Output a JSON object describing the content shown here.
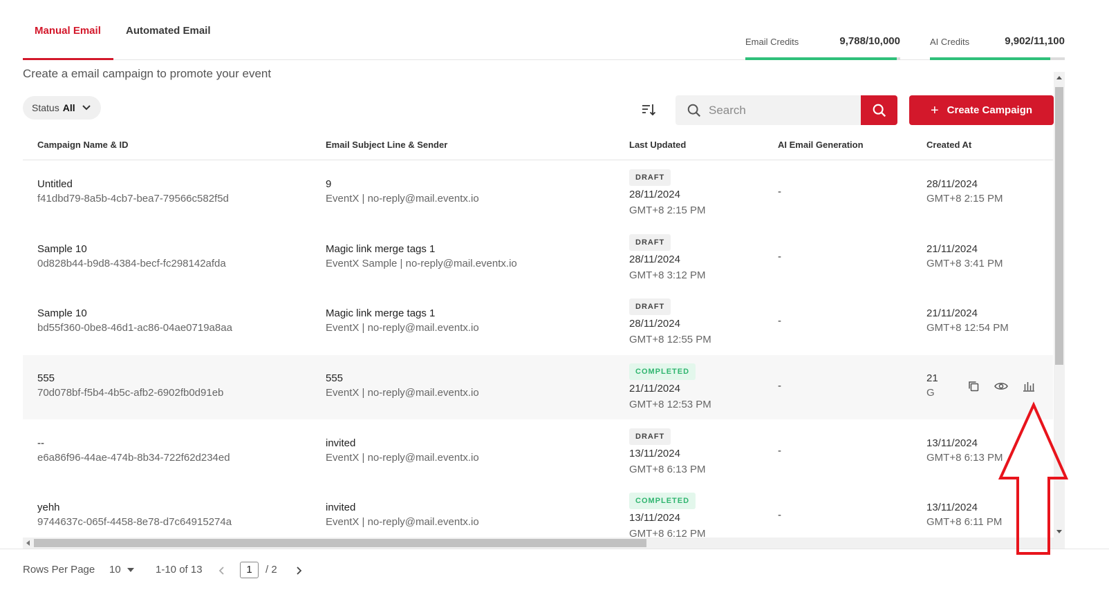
{
  "tabs": [
    {
      "label": "Manual Email",
      "active": true
    },
    {
      "label": "Automated Email",
      "active": false
    }
  ],
  "credits": {
    "email": {
      "label": "Email Credits",
      "value": "9,788/10,000",
      "fraction": 0.9788
    },
    "ai": {
      "label": "AI Credits",
      "value": "9,902/11,100",
      "fraction": 0.892
    }
  },
  "subtitle": "Create a email campaign to promote your event",
  "filter": {
    "label": "Status",
    "value": "All"
  },
  "search": {
    "placeholder": "Search"
  },
  "create_button": {
    "label": "Create Campaign"
  },
  "table": {
    "headers": [
      "Campaign Name & ID",
      "Email Subject Line & Sender",
      "Last Updated",
      "AI Email Generation",
      "Created At"
    ],
    "rows": [
      {
        "name": "Untitled",
        "id": "f41dbd79-8a5b-4cb7-bea7-79566c582f5d",
        "subject": "9",
        "sender": "EventX | no-reply@mail.eventx.io",
        "status": "DRAFT",
        "updated_date": "28/11/2024",
        "updated_time": "GMT+8 2:15 PM",
        "ai": "-",
        "created_date": "28/11/2024",
        "created_time": "GMT+8 2:15 PM"
      },
      {
        "name": "Sample 10",
        "id": "0d828b44-b9d8-4384-becf-fc298142afda",
        "subject": "Magic link merge tags 1",
        "sender": "EventX Sample | no-reply@mail.eventx.io",
        "status": "DRAFT",
        "updated_date": "28/11/2024",
        "updated_time": "GMT+8 3:12 PM",
        "ai": "-",
        "created_date": "21/11/2024",
        "created_time": "GMT+8 3:41 PM"
      },
      {
        "name": "Sample 10",
        "id": "bd55f360-0be8-46d1-ac86-04ae0719a8aa",
        "subject": "Magic link merge tags 1",
        "sender": "EventX | no-reply@mail.eventx.io",
        "status": "DRAFT",
        "updated_date": "28/11/2024",
        "updated_time": "GMT+8 12:55 PM",
        "ai": "-",
        "created_date": "21/11/2024",
        "created_time": "GMT+8 12:54 PM"
      },
      {
        "name": "555",
        "id": "70d078bf-f5b4-4b5c-afb2-6902fb0d91eb",
        "subject": "555",
        "sender": "EventX | no-reply@mail.eventx.io",
        "status": "COMPLETED",
        "updated_date": "21/11/2024",
        "updated_time": "GMT+8 12:53 PM",
        "ai": "-",
        "created_date": "21",
        "created_time": "G"
      },
      {
        "name": "--",
        "id": "e6a86f96-44ae-474b-8b34-722f62d234ed",
        "subject": "invited",
        "sender": "EventX | no-reply@mail.eventx.io",
        "status": "DRAFT",
        "updated_date": "13/11/2024",
        "updated_time": "GMT+8 6:13 PM",
        "ai": "-",
        "created_date": "13/11/2024",
        "created_time": "GMT+8 6:13 PM"
      },
      {
        "name": "yehh",
        "id": "9744637c-065f-4458-8e78-d7c64915274a",
        "subject": "invited",
        "sender": "EventX | no-reply@mail.eventx.io",
        "status": "COMPLETED",
        "updated_date": "13/11/2024",
        "updated_time": "GMT+8 6:12 PM",
        "ai": "-",
        "created_date": "13/11/2024",
        "created_time": "GMT+8 6:11 PM"
      }
    ]
  },
  "row_action_icons": [
    "copy-icon",
    "eye-icon",
    "bar-chart-icon"
  ],
  "pagination": {
    "rows_label": "Rows Per Page",
    "rows_value": "10",
    "range": "1-10 of 13",
    "current_page": "1",
    "total_pages": "/  2"
  },
  "colors": {
    "brand": "#d3182b",
    "success": "#2fc07a"
  }
}
